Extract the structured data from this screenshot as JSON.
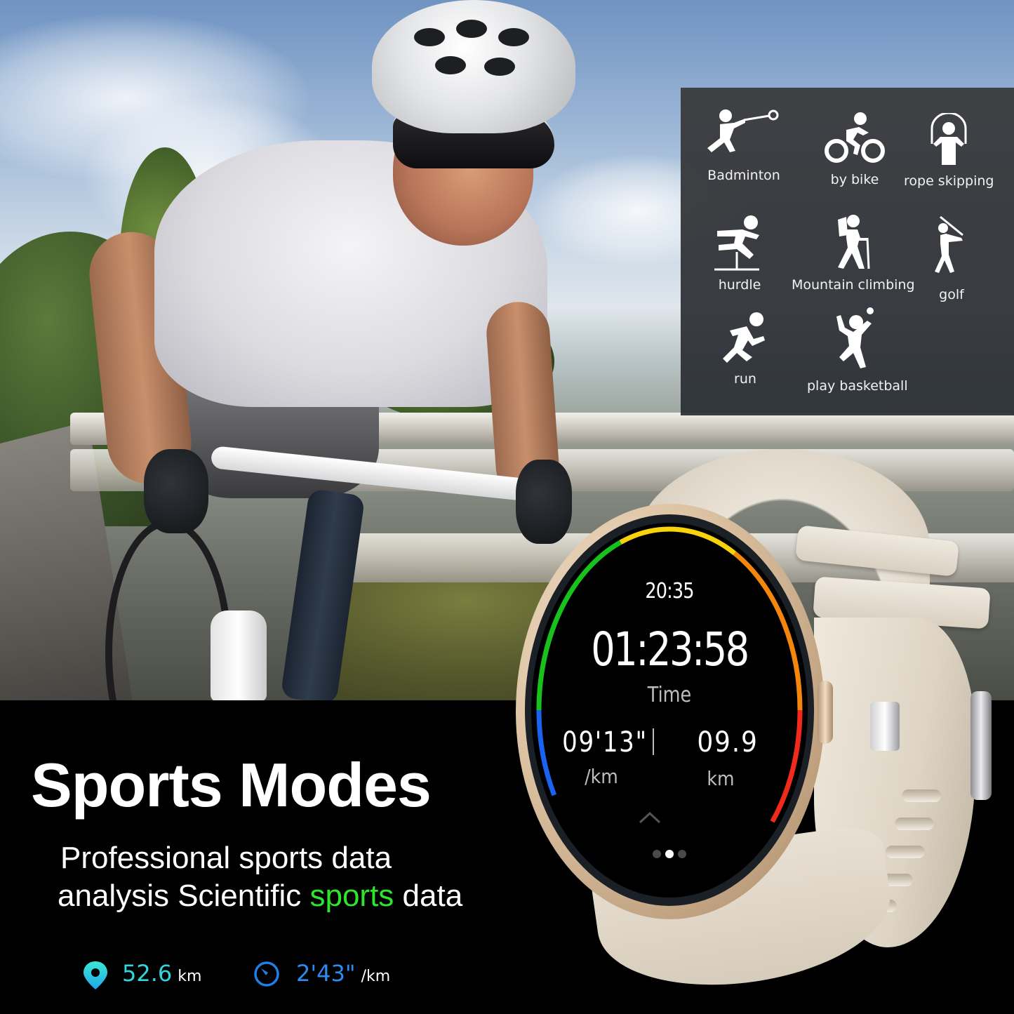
{
  "hero": {
    "title": "Sports Modes",
    "subtitle_line1": "Professional sports data",
    "subtitle_line2_before": "analysis Scientific ",
    "subtitle_line2_highlight": "sports",
    "subtitle_line2_after": " data",
    "highlight_color": "#2ee52b"
  },
  "sports_modes": [
    {
      "label": "Badminton",
      "icon": "badminton-icon"
    },
    {
      "label": "by bike",
      "icon": "cycling-icon"
    },
    {
      "label": "rope skipping",
      "icon": "rope-skipping-icon"
    },
    {
      "label": "hurdle",
      "icon": "hurdle-icon"
    },
    {
      "label": "Mountain climbing",
      "icon": "hiking-icon"
    },
    {
      "label": "golf",
      "icon": "golf-icon"
    },
    {
      "label": "run",
      "icon": "running-icon"
    },
    {
      "label": "play basketball",
      "icon": "ball-player-icon"
    }
  ],
  "stats": [
    {
      "icon": "location-pin-icon",
      "value": "52.6",
      "unit": "km",
      "color": "#2fd6e0"
    },
    {
      "icon": "speedometer-icon",
      "value": "2'43\"",
      "unit": "/km",
      "color": "#2a8cf0"
    }
  ],
  "watch": {
    "clock": "20:35",
    "timer": "01:23:58",
    "timer_label": "Time",
    "pace_value": "09'13\"",
    "pace_unit": "/km",
    "distance_value": "09.9",
    "distance_unit": "km",
    "page_indicator": {
      "total": 3,
      "active": 2
    },
    "ring_colors": [
      "#1a62f0",
      "#16c21b",
      "#f8d20a",
      "#f5860d",
      "#f22a1c"
    ]
  }
}
